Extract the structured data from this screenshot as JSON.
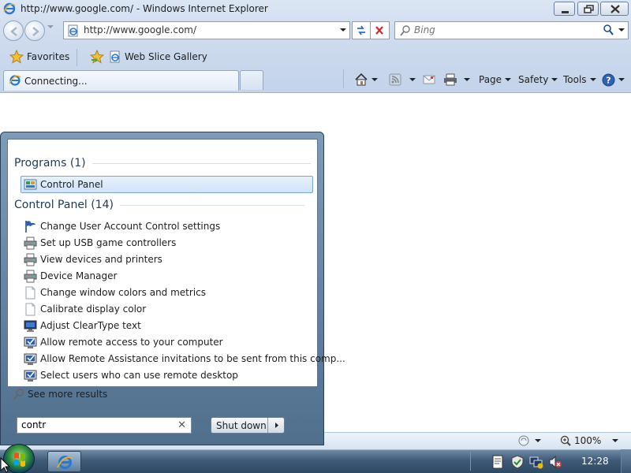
{
  "window": {
    "title": "http://www.google.com/ - Windows Internet Explorer"
  },
  "address_bar": {
    "url": "http://www.google.com/"
  },
  "search_box": {
    "placeholder": "Bing"
  },
  "favorites_bar": {
    "favorites_label": "Favorites",
    "web_slice_label": "Web Slice Gallery"
  },
  "tab": {
    "label": "Connecting..."
  },
  "command_bar": {
    "page_label": "Page",
    "safety_label": "Safety",
    "tools_label": "Tools"
  },
  "start_menu": {
    "programs_heading": "Programs (1)",
    "program_item": "Control Panel",
    "control_panel_heading": "Control Panel (14)",
    "control_panel_items": [
      {
        "label": "Change User Account Control settings",
        "icon": "flag-icon"
      },
      {
        "label": "Set up USB game controllers",
        "icon": "devices-icon"
      },
      {
        "label": "View devices and printers",
        "icon": "devices-icon"
      },
      {
        "label": "Device Manager",
        "icon": "devices-icon"
      },
      {
        "label": "Change window colors and metrics",
        "icon": "blank-page-icon"
      },
      {
        "label": "Calibrate display color",
        "icon": "blank-page-icon"
      },
      {
        "label": "Adjust ClearType text",
        "icon": "monitor-icon"
      },
      {
        "label": "Allow remote access to your computer",
        "icon": "remote-icon"
      },
      {
        "label": "Allow Remote Assistance invitations to be sent from this comp...",
        "icon": "remote-icon"
      },
      {
        "label": "Select users who can use remote desktop",
        "icon": "remote-icon"
      }
    ],
    "see_more": "See more results",
    "search_value": "contr",
    "shutdown_label": "Shut down"
  },
  "status_bar": {
    "zoom": "100%"
  },
  "taskbar": {
    "clock": "12:28"
  }
}
